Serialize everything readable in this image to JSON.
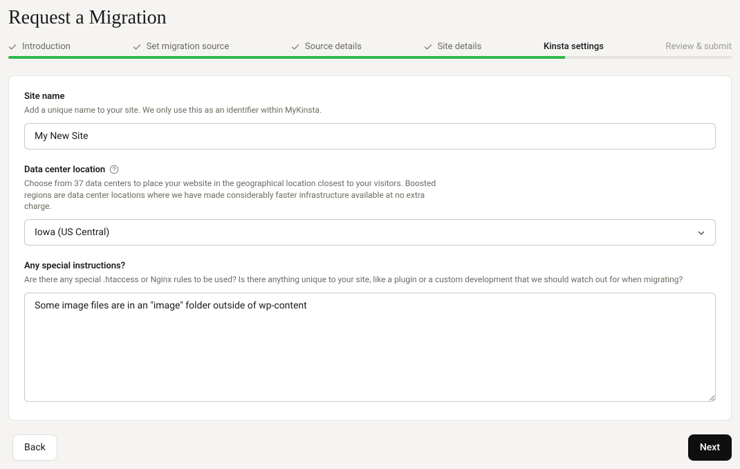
{
  "page": {
    "title": "Request a Migration"
  },
  "stepper": {
    "steps": [
      {
        "label": "Introduction",
        "state": "done"
      },
      {
        "label": "Set migration source",
        "state": "done"
      },
      {
        "label": "Source details",
        "state": "done"
      },
      {
        "label": "Site details",
        "state": "done"
      },
      {
        "label": "Kinsta settings",
        "state": "active"
      },
      {
        "label": "Review & submit",
        "state": "pending"
      }
    ],
    "progress_percent": 77
  },
  "form": {
    "site_name": {
      "label": "Site name",
      "hint": "Add a unique name to your site. We only use this as an identifier within MyKinsta.",
      "value": "My New Site"
    },
    "data_center": {
      "label": "Data center location",
      "hint": "Choose from 37 data centers to place your website in the geographical location closest to your visitors. Boosted regions are data center locations where we have made considerably faster infrastructure available at no extra charge.",
      "value": "Iowa (US Central)"
    },
    "instructions": {
      "label": "Any special instructions?",
      "hint": "Are there any special .htaccess or Nginx rules to be used? Is there anything unique to your site, like a plugin or a custom development that we should watch out for when migrating?",
      "value": "Some image files are in an \"image\" folder outside of wp-content"
    }
  },
  "footer": {
    "back_label": "Back",
    "next_label": "Next"
  }
}
